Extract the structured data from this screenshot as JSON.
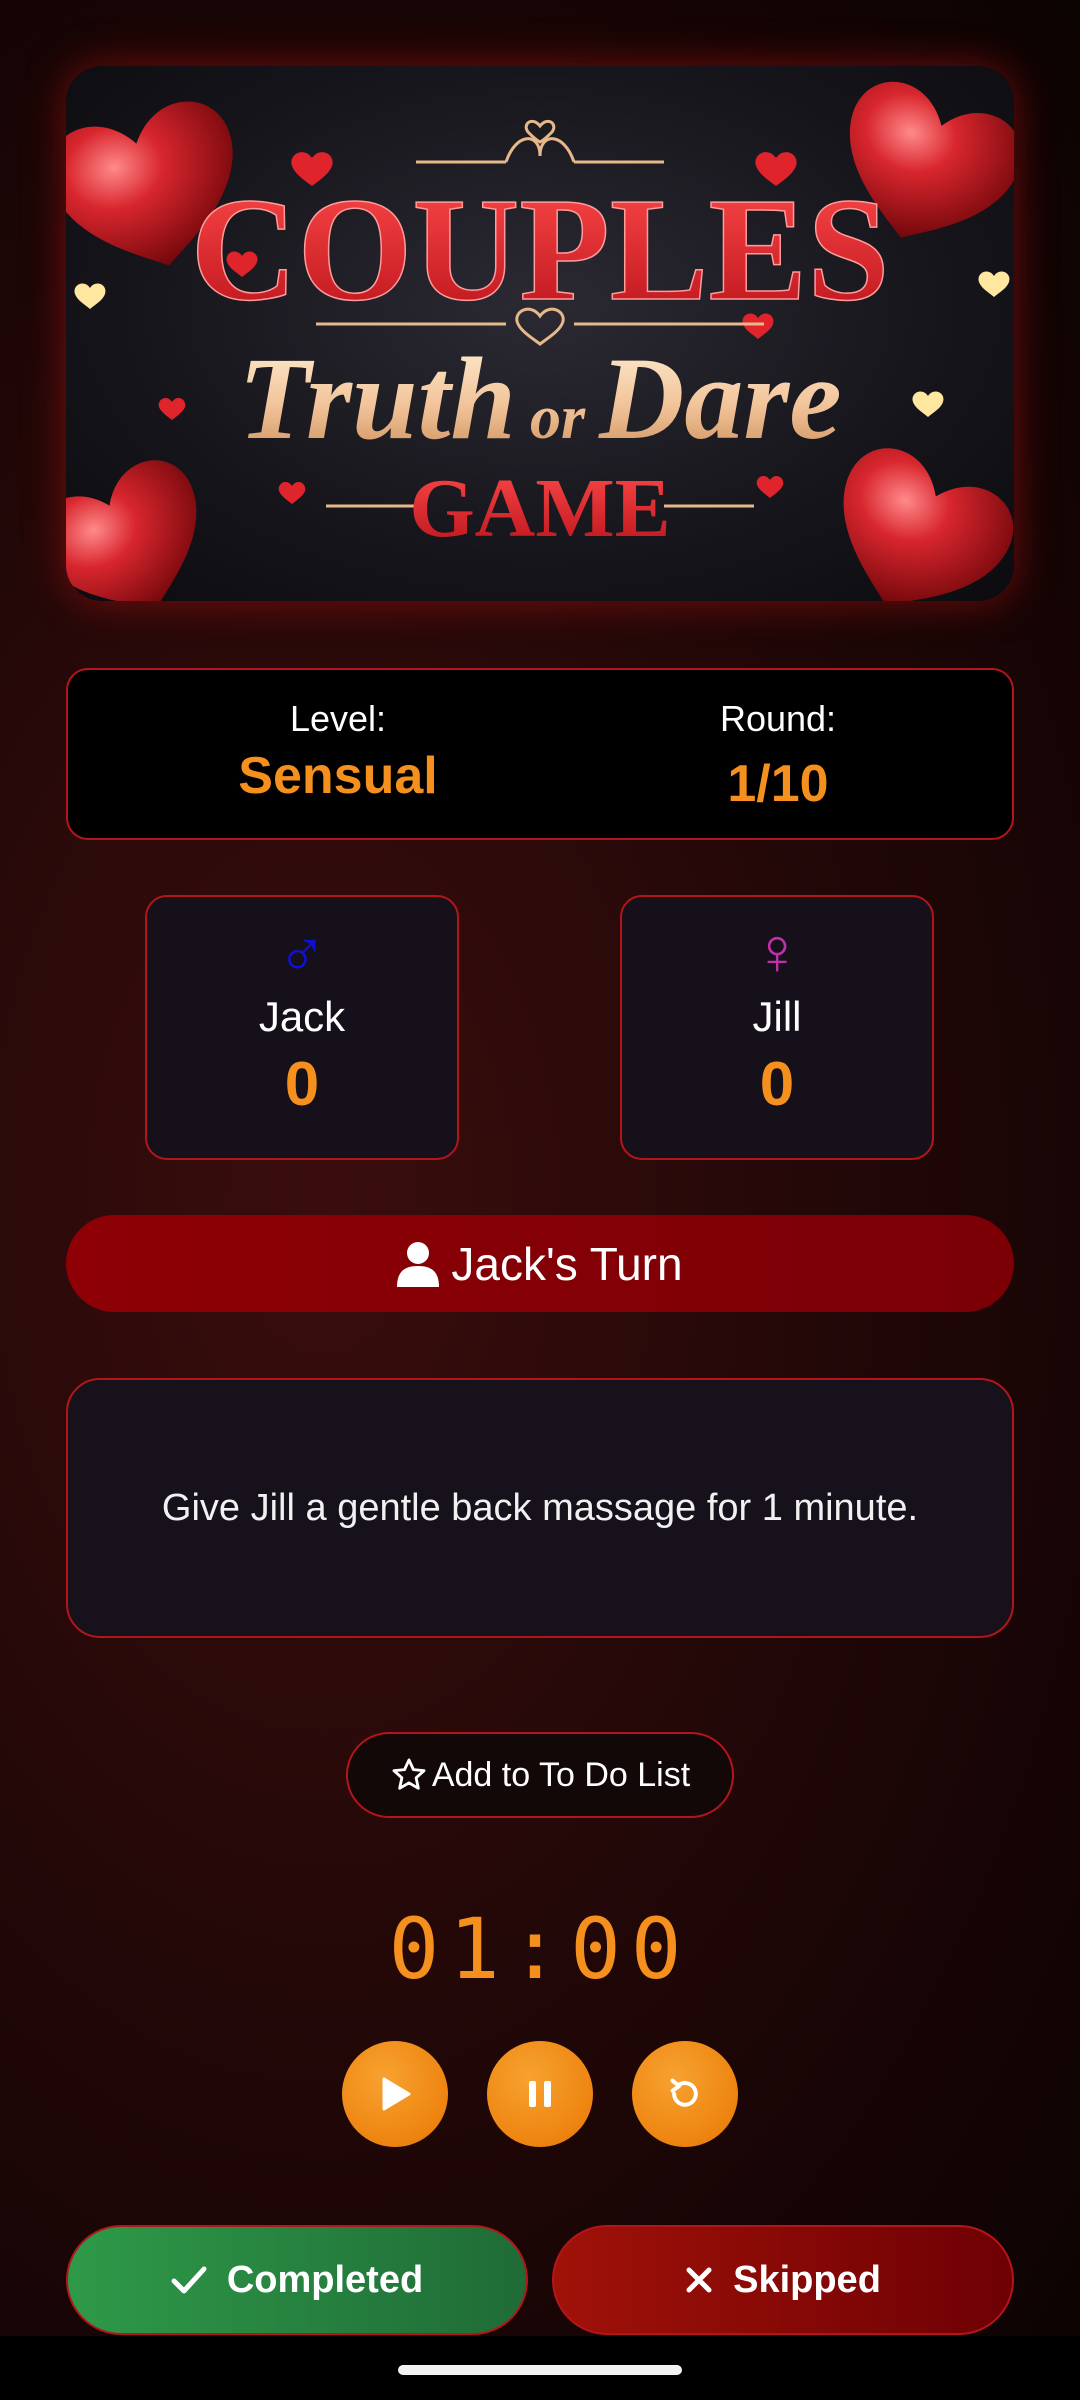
{
  "banner": {
    "line1": "COUPLES",
    "line2_a": "Truth",
    "line2_or": "or",
    "line2_b": "Dare",
    "line3": "GAME"
  },
  "info": {
    "level_label": "Level:",
    "level_value": "Sensual",
    "round_label": "Round:",
    "round_value": "1/10"
  },
  "players": [
    {
      "name": "Jack",
      "score": "0",
      "symbol": "♂",
      "color": "#1010d8"
    },
    {
      "name": "Jill",
      "score": "0",
      "symbol": "♀",
      "color": "#c030a8"
    }
  ],
  "turn": {
    "label": "Jack's Turn",
    "icon": "person-icon"
  },
  "task": {
    "text": "Give Jill a gentle back massage for 1 minute."
  },
  "todo": {
    "label": "Add to To Do List",
    "icon": "star-outline-icon"
  },
  "timer": {
    "display": "01:00"
  },
  "controls": {
    "play": "play-icon",
    "pause": "pause-icon",
    "reset": "reset-icon"
  },
  "actions": {
    "completed_label": "Completed",
    "skipped_label": "Skipped"
  },
  "colors": {
    "accent": "#f5901e",
    "border": "#b3151a",
    "turn_bar": "#8e0005",
    "completed": "#2e9a48",
    "skipped": "#a01208"
  }
}
